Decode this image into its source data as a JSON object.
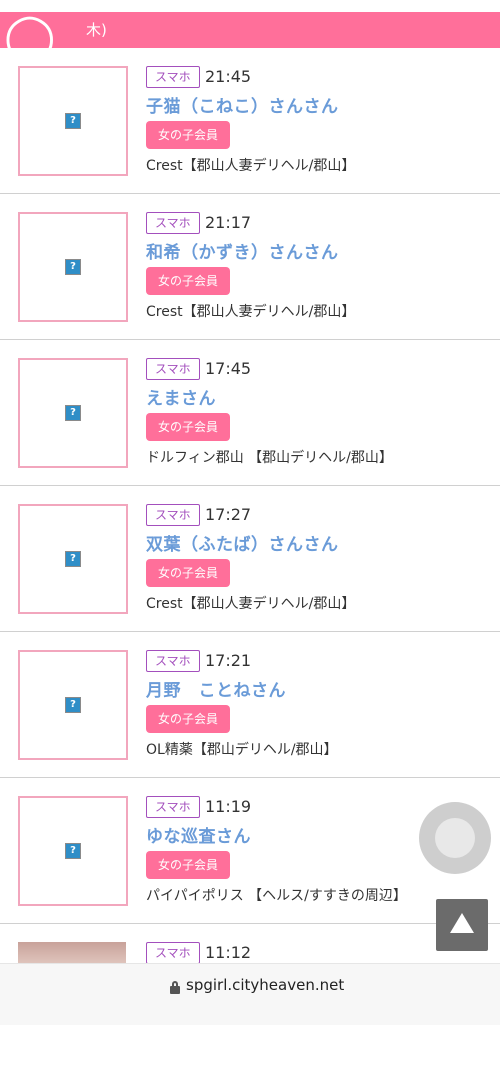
{
  "header": {
    "title_fragment": "木)"
  },
  "listing": {
    "items": [
      {
        "device": "スマホ",
        "time": "21:45",
        "name": "子猫（こねこ）さんさん",
        "member_badge": "女の子会員",
        "shop": "Crest【郡山人妻デリヘル/郡山】"
      },
      {
        "device": "スマホ",
        "time": "21:17",
        "name": "和希（かずき）さんさん",
        "member_badge": "女の子会員",
        "shop": "Crest【郡山人妻デリヘル/郡山】"
      },
      {
        "device": "スマホ",
        "time": "17:45",
        "name": "えまさん",
        "member_badge": "女の子会員",
        "shop": "ドルフィン郡山 【郡山デリヘル/郡山】"
      },
      {
        "device": "スマホ",
        "time": "17:27",
        "name": "双葉（ふたば）さんさん",
        "member_badge": "女の子会員",
        "shop": "Crest【郡山人妻デリヘル/郡山】"
      },
      {
        "device": "スマホ",
        "time": "17:21",
        "name": "月野　ことねさん",
        "member_badge": "女の子会員",
        "shop": "OL精薬【郡山デリヘル/郡山】"
      },
      {
        "device": "スマホ",
        "time": "11:19",
        "name": "ゆな巡査さん",
        "member_badge": "女の子会員",
        "shop": "パイパイポリス 【ヘルス/すすきの周辺】"
      },
      {
        "device": "スマホ",
        "time": "11:12"
      }
    ],
    "broken_image_glyph": "?"
  },
  "browser": {
    "url": "spgirl.cityheaven.net"
  },
  "colors": {
    "accent": "#ff6f9a",
    "name_link": "#6a9bd8",
    "device_badge": "#a34fbd"
  },
  "icons": {
    "lock": "lock-icon",
    "scroll_top": "arrow-up-icon",
    "assistive_touch": "assistive-touch-icon"
  }
}
